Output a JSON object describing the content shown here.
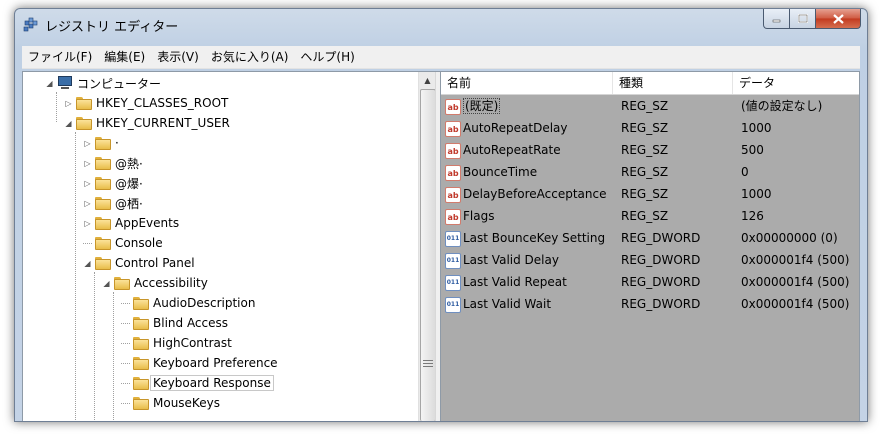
{
  "window": {
    "title": "レジストリ エディター"
  },
  "menu": [
    "ファイル(F)",
    "編集(E)",
    "表示(V)",
    "お気に入り(A)",
    "ヘルプ(H)"
  ],
  "tree": [
    {
      "label": "コンピューター",
      "level": 0,
      "expander": "expanded",
      "icon": "computer-icon"
    },
    {
      "label": "HKEY_CLASSES_ROOT",
      "level": 1,
      "expander": "collapsed",
      "icon": "folder-icon"
    },
    {
      "label": "HKEY_CURRENT_USER",
      "level": 1,
      "expander": "expanded",
      "icon": "folder-icon"
    },
    {
      "label": "·",
      "level": 2,
      "expander": "collapsed",
      "icon": "folder-icon"
    },
    {
      "label": "@熱·",
      "level": 2,
      "expander": "collapsed",
      "icon": "folder-icon"
    },
    {
      "label": "@爆·",
      "level": 2,
      "expander": "collapsed",
      "icon": "folder-icon"
    },
    {
      "label": "@栖·",
      "level": 2,
      "expander": "collapsed",
      "icon": "folder-icon"
    },
    {
      "label": "AppEvents",
      "level": 2,
      "expander": "collapsed",
      "icon": "folder-icon"
    },
    {
      "label": "Console",
      "level": 2,
      "expander": "none",
      "icon": "folder-icon"
    },
    {
      "label": "Control Panel",
      "level": 2,
      "expander": "expanded",
      "icon": "folder-icon"
    },
    {
      "label": "Accessibility",
      "level": 3,
      "expander": "expanded",
      "icon": "folder-icon"
    },
    {
      "label": "AudioDescription",
      "level": 4,
      "expander": "none",
      "icon": "folder-icon"
    },
    {
      "label": "Blind Access",
      "level": 4,
      "expander": "none",
      "icon": "folder-icon"
    },
    {
      "label": "HighContrast",
      "level": 4,
      "expander": "none",
      "icon": "folder-icon"
    },
    {
      "label": "Keyboard Preference",
      "level": 4,
      "expander": "none",
      "icon": "folder-icon"
    },
    {
      "label": "Keyboard Response",
      "level": 4,
      "expander": "none",
      "icon": "folder-icon",
      "selected": true
    },
    {
      "label": "MouseKeys",
      "level": 4,
      "expander": "none",
      "icon": "folder-icon"
    }
  ],
  "list": {
    "columns": [
      "名前",
      "種類",
      "データ"
    ],
    "rows": [
      {
        "name": "(既定)",
        "type": "REG_SZ",
        "data": "(値の設定なし)",
        "icon": "string-value-icon"
      },
      {
        "name": "AutoRepeatDelay",
        "type": "REG_SZ",
        "data": "1000",
        "icon": "string-value-icon"
      },
      {
        "name": "AutoRepeatRate",
        "type": "REG_SZ",
        "data": "500",
        "icon": "string-value-icon"
      },
      {
        "name": "BounceTime",
        "type": "REG_SZ",
        "data": "0",
        "icon": "string-value-icon"
      },
      {
        "name": "DelayBeforeAcceptance",
        "type": "REG_SZ",
        "data": "1000",
        "icon": "string-value-icon"
      },
      {
        "name": "Flags",
        "type": "REG_SZ",
        "data": "126",
        "icon": "string-value-icon"
      },
      {
        "name": "Last BounceKey Setting",
        "type": "REG_DWORD",
        "data": "0x00000000 (0)",
        "icon": "dword-value-icon"
      },
      {
        "name": "Last Valid Delay",
        "type": "REG_DWORD",
        "data": "0x000001f4 (500)",
        "icon": "dword-value-icon"
      },
      {
        "name": "Last Valid Repeat",
        "type": "REG_DWORD",
        "data": "0x000001f4 (500)",
        "icon": "dword-value-icon"
      },
      {
        "name": "Last Valid Wait",
        "type": "REG_DWORD",
        "data": "0x000001f4 (500)",
        "icon": "dword-value-icon"
      }
    ]
  },
  "icons": {
    "string": "ab",
    "dword": "011"
  },
  "colors": {
    "list_background": "#ababab",
    "close_button": "#c23a1f"
  }
}
